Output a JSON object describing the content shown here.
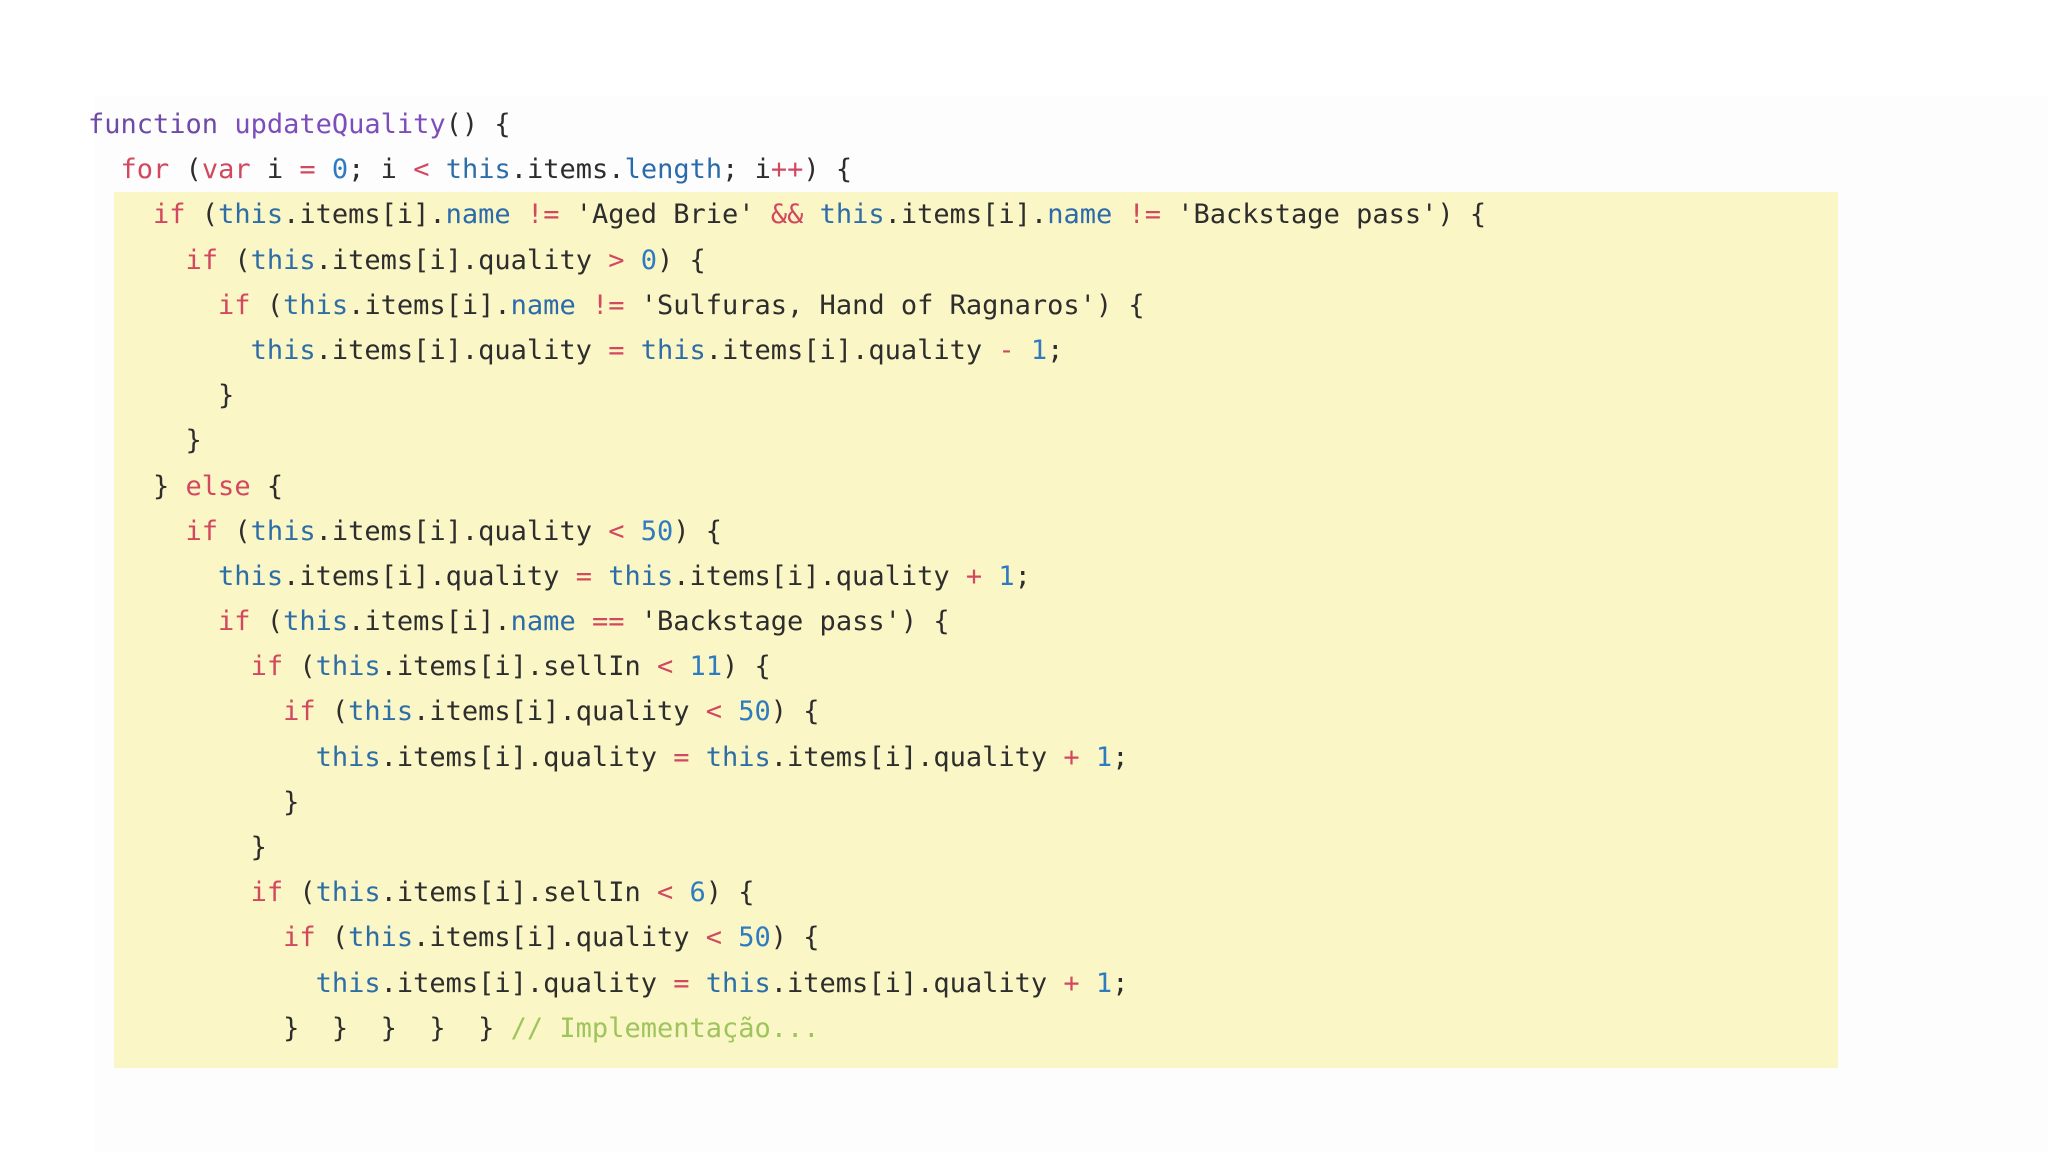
{
  "colors": {
    "background": "#ffffff",
    "panel": "#fdfdfd",
    "highlight": "#faf6c6",
    "keyword": "#d1485f",
    "function": "#7c4dbb",
    "this": "#2e6ea6",
    "number": "#2f7bbf",
    "comment": "#9ec45c",
    "text": "#2d2d2d"
  },
  "code": {
    "lines": [
      [
        [
          "fn-kw",
          "function"
        ],
        [
          "plain",
          " "
        ],
        [
          "fn",
          "updateQuality"
        ],
        [
          "punc",
          "() {"
        ]
      ],
      [
        [
          "plain",
          "  "
        ],
        [
          "kw",
          "for"
        ],
        [
          "punc",
          " ("
        ],
        [
          "kw",
          "var"
        ],
        [
          "plain",
          " i "
        ],
        [
          "op",
          "="
        ],
        [
          "plain",
          " "
        ],
        [
          "num",
          "0"
        ],
        [
          "punc",
          "; i "
        ],
        [
          "op",
          "<"
        ],
        [
          "plain",
          " "
        ],
        [
          "this",
          "this"
        ],
        [
          "punc",
          ".items."
        ],
        [
          "prop",
          "length"
        ],
        [
          "punc",
          "; i"
        ],
        [
          "op",
          "++"
        ],
        [
          "punc",
          ") {"
        ]
      ],
      [
        [
          "plain",
          "    "
        ],
        [
          "kw",
          "if"
        ],
        [
          "punc",
          " ("
        ],
        [
          "this",
          "this"
        ],
        [
          "punc",
          ".items[i]."
        ],
        [
          "prop",
          "name"
        ],
        [
          "plain",
          " "
        ],
        [
          "op",
          "!="
        ],
        [
          "plain",
          " "
        ],
        [
          "str",
          "'Aged Brie'"
        ],
        [
          "plain",
          " "
        ],
        [
          "op",
          "&&"
        ],
        [
          "plain",
          " "
        ],
        [
          "this",
          "this"
        ],
        [
          "punc",
          ".items[i]."
        ],
        [
          "prop",
          "name"
        ],
        [
          "plain",
          " "
        ],
        [
          "op",
          "!="
        ],
        [
          "plain",
          " "
        ],
        [
          "str",
          "'Backstage pass'"
        ],
        [
          "punc",
          ") {"
        ]
      ],
      [
        [
          "plain",
          "      "
        ],
        [
          "kw",
          "if"
        ],
        [
          "punc",
          " ("
        ],
        [
          "this",
          "this"
        ],
        [
          "punc",
          ".items[i].quality "
        ],
        [
          "op",
          ">"
        ],
        [
          "plain",
          " "
        ],
        [
          "num",
          "0"
        ],
        [
          "punc",
          ") {"
        ]
      ],
      [
        [
          "plain",
          "        "
        ],
        [
          "kw",
          "if"
        ],
        [
          "punc",
          " ("
        ],
        [
          "this",
          "this"
        ],
        [
          "punc",
          ".items[i]."
        ],
        [
          "prop",
          "name"
        ],
        [
          "plain",
          " "
        ],
        [
          "op",
          "!="
        ],
        [
          "plain",
          " "
        ],
        [
          "str",
          "'Sulfuras, Hand of Ragnaros'"
        ],
        [
          "punc",
          ") {"
        ]
      ],
      [
        [
          "plain",
          "          "
        ],
        [
          "this",
          "this"
        ],
        [
          "punc",
          ".items[i].quality "
        ],
        [
          "op",
          "="
        ],
        [
          "plain",
          " "
        ],
        [
          "this",
          "this"
        ],
        [
          "punc",
          ".items[i].quality "
        ],
        [
          "op",
          "-"
        ],
        [
          "plain",
          " "
        ],
        [
          "num",
          "1"
        ],
        [
          "punc",
          ";"
        ]
      ],
      [
        [
          "plain",
          "        "
        ],
        [
          "punc",
          "}"
        ]
      ],
      [
        [
          "plain",
          "      "
        ],
        [
          "punc",
          "}"
        ]
      ],
      [
        [
          "plain",
          "    "
        ],
        [
          "punc",
          "} "
        ],
        [
          "kw",
          "else"
        ],
        [
          "punc",
          " {"
        ]
      ],
      [
        [
          "plain",
          "      "
        ],
        [
          "kw",
          "if"
        ],
        [
          "punc",
          " ("
        ],
        [
          "this",
          "this"
        ],
        [
          "punc",
          ".items[i].quality "
        ],
        [
          "op",
          "<"
        ],
        [
          "plain",
          " "
        ],
        [
          "num",
          "50"
        ],
        [
          "punc",
          ") {"
        ]
      ],
      [
        [
          "plain",
          "        "
        ],
        [
          "this",
          "this"
        ],
        [
          "punc",
          ".items[i].quality "
        ],
        [
          "op",
          "="
        ],
        [
          "plain",
          " "
        ],
        [
          "this",
          "this"
        ],
        [
          "punc",
          ".items[i].quality "
        ],
        [
          "op",
          "+"
        ],
        [
          "plain",
          " "
        ],
        [
          "num",
          "1"
        ],
        [
          "punc",
          ";"
        ]
      ],
      [
        [
          "plain",
          "        "
        ],
        [
          "kw",
          "if"
        ],
        [
          "punc",
          " ("
        ],
        [
          "this",
          "this"
        ],
        [
          "punc",
          ".items[i]."
        ],
        [
          "prop",
          "name"
        ],
        [
          "plain",
          " "
        ],
        [
          "op",
          "=="
        ],
        [
          "plain",
          " "
        ],
        [
          "str",
          "'Backstage pass'"
        ],
        [
          "punc",
          ") {"
        ]
      ],
      [
        [
          "plain",
          "          "
        ],
        [
          "kw",
          "if"
        ],
        [
          "punc",
          " ("
        ],
        [
          "this",
          "this"
        ],
        [
          "punc",
          ".items[i].sellIn "
        ],
        [
          "op",
          "<"
        ],
        [
          "plain",
          " "
        ],
        [
          "num",
          "11"
        ],
        [
          "punc",
          ") {"
        ]
      ],
      [
        [
          "plain",
          "            "
        ],
        [
          "kw",
          "if"
        ],
        [
          "punc",
          " ("
        ],
        [
          "this",
          "this"
        ],
        [
          "punc",
          ".items[i].quality "
        ],
        [
          "op",
          "<"
        ],
        [
          "plain",
          " "
        ],
        [
          "num",
          "50"
        ],
        [
          "punc",
          ") {"
        ]
      ],
      [
        [
          "plain",
          "              "
        ],
        [
          "this",
          "this"
        ],
        [
          "punc",
          ".items[i].quality "
        ],
        [
          "op",
          "="
        ],
        [
          "plain",
          " "
        ],
        [
          "this",
          "this"
        ],
        [
          "punc",
          ".items[i].quality "
        ],
        [
          "op",
          "+"
        ],
        [
          "plain",
          " "
        ],
        [
          "num",
          "1"
        ],
        [
          "punc",
          ";"
        ]
      ],
      [
        [
          "plain",
          "            "
        ],
        [
          "punc",
          "}"
        ]
      ],
      [
        [
          "plain",
          "          "
        ],
        [
          "punc",
          "}"
        ]
      ],
      [
        [
          "plain",
          "          "
        ],
        [
          "kw",
          "if"
        ],
        [
          "punc",
          " ("
        ],
        [
          "this",
          "this"
        ],
        [
          "punc",
          ".items[i].sellIn "
        ],
        [
          "op",
          "<"
        ],
        [
          "plain",
          " "
        ],
        [
          "num",
          "6"
        ],
        [
          "punc",
          ") {"
        ]
      ],
      [
        [
          "plain",
          "            "
        ],
        [
          "kw",
          "if"
        ],
        [
          "punc",
          " ("
        ],
        [
          "this",
          "this"
        ],
        [
          "punc",
          ".items[i].quality "
        ],
        [
          "op",
          "<"
        ],
        [
          "plain",
          " "
        ],
        [
          "num",
          "50"
        ],
        [
          "punc",
          ") {"
        ]
      ],
      [
        [
          "plain",
          "              "
        ],
        [
          "this",
          "this"
        ],
        [
          "punc",
          ".items[i].quality "
        ],
        [
          "op",
          "="
        ],
        [
          "plain",
          " "
        ],
        [
          "this",
          "this"
        ],
        [
          "punc",
          ".items[i].quality "
        ],
        [
          "op",
          "+"
        ],
        [
          "plain",
          " "
        ],
        [
          "num",
          "1"
        ],
        [
          "punc",
          ";"
        ]
      ],
      [
        [
          "plain",
          "            "
        ],
        [
          "punc",
          "}  }  }  }  } "
        ],
        [
          "cmt",
          "// Implementação..."
        ]
      ]
    ]
  }
}
